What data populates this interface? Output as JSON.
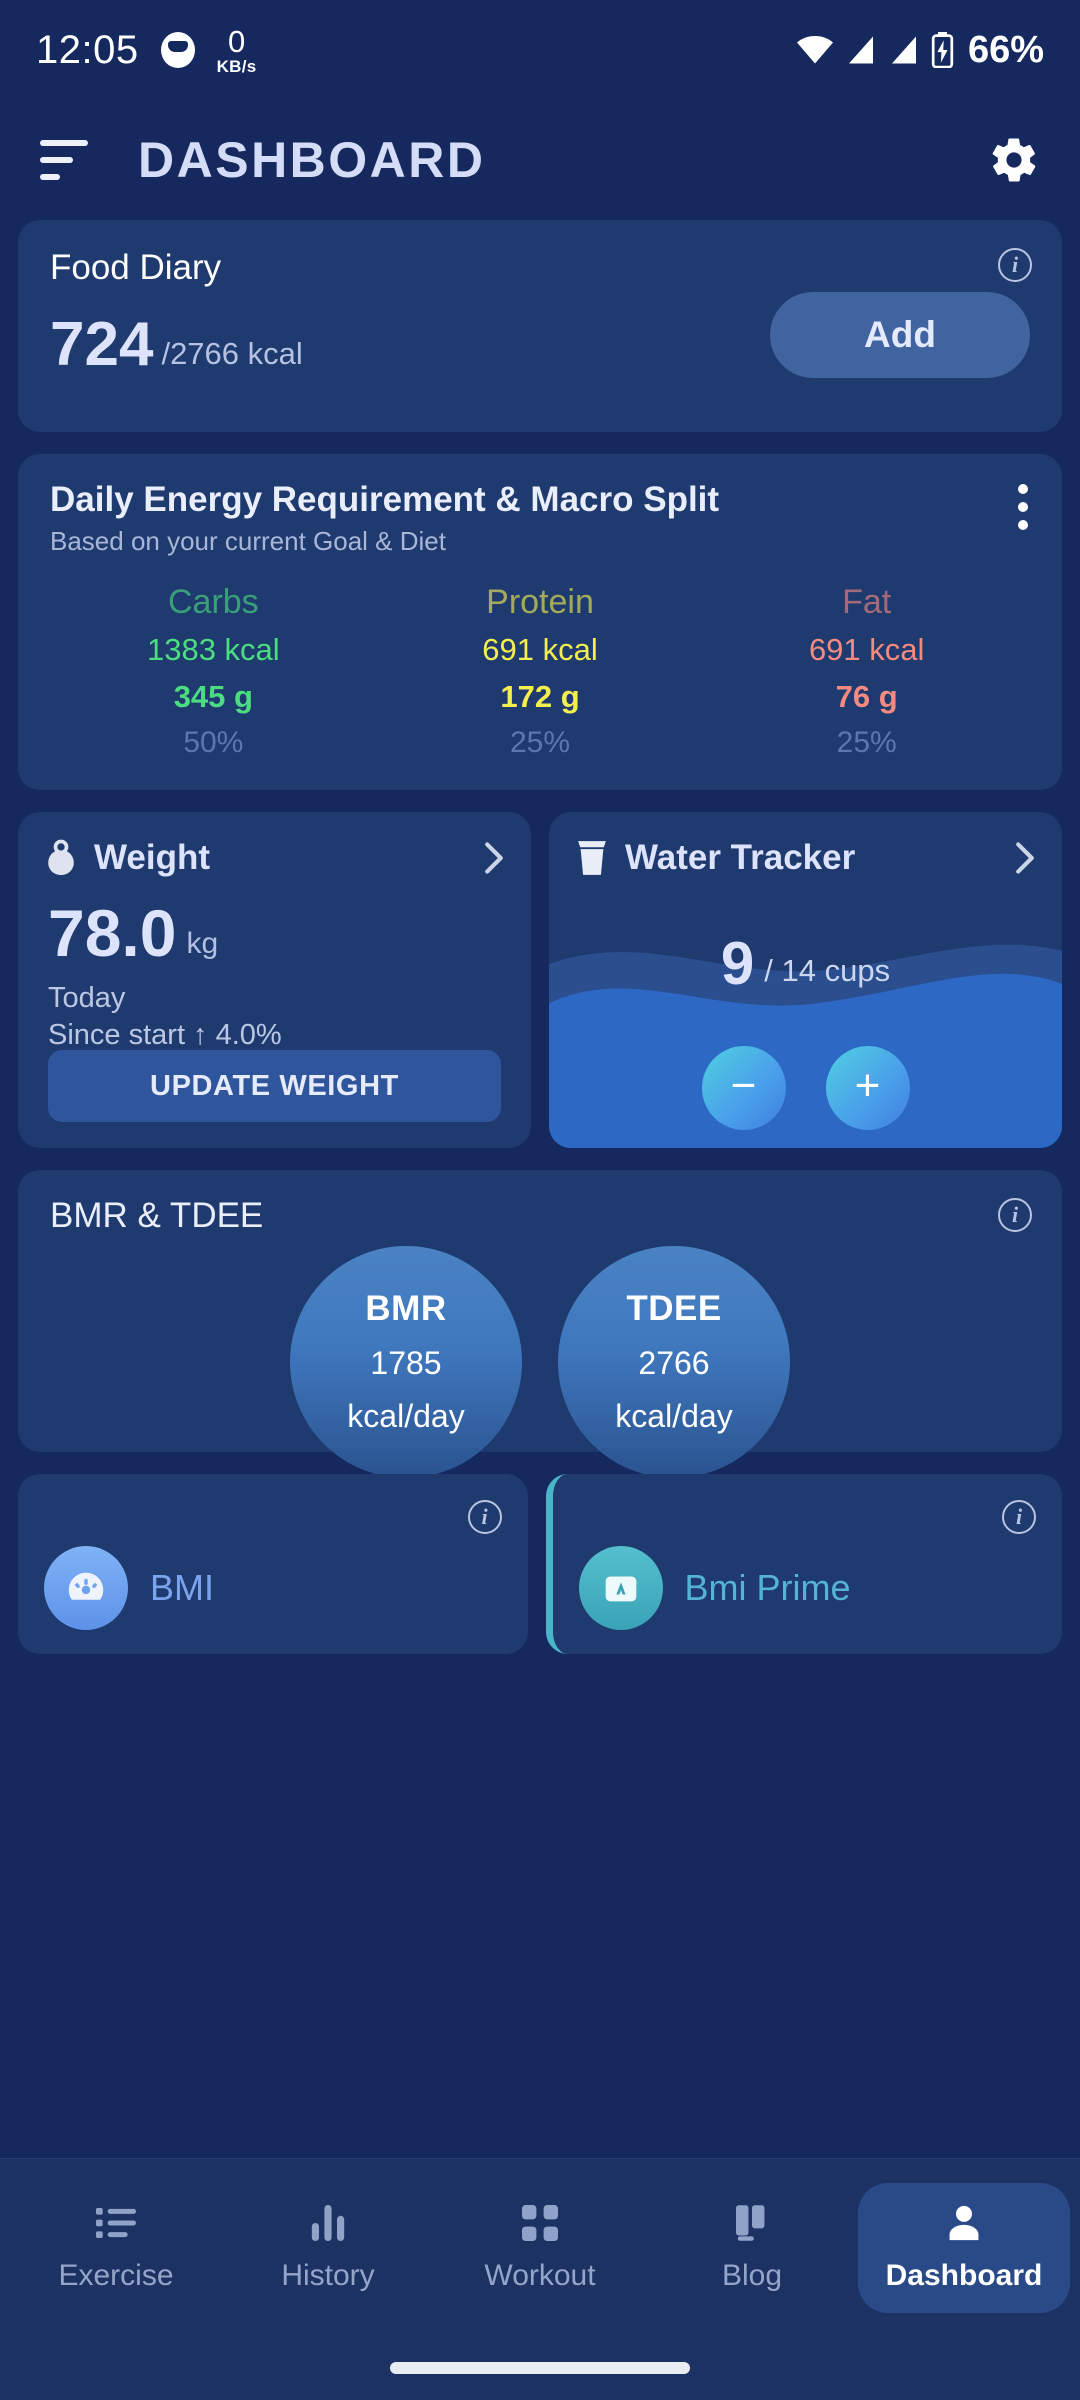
{
  "status_bar": {
    "time": "12:05",
    "net_speed_value": "0",
    "net_speed_unit": "KB/s",
    "battery_percent": "66%"
  },
  "app_bar": {
    "title": "DASHBOARD"
  },
  "food_diary": {
    "title": "Food Diary",
    "consumed": "724",
    "target": "/2766 kcal",
    "add_label": "Add",
    "info": "i"
  },
  "macro": {
    "title": "Daily Energy Requirement & Macro Split",
    "subtitle": "Based on your current Goal & Diet",
    "columns": [
      {
        "label": "Carbs",
        "kcal": "1383 kcal",
        "grams": "345 g",
        "percent": "50%",
        "color": "#4ade80"
      },
      {
        "label": "Protein",
        "kcal": "691 kcal",
        "grams": "172 g",
        "percent": "25%",
        "color": "#f5ef4e"
      },
      {
        "label": "Fat",
        "kcal": "691 kcal",
        "grams": "76 g",
        "percent": "25%",
        "color": "#f58a80"
      }
    ]
  },
  "weight": {
    "title": "Weight",
    "value": "78.0",
    "unit": "kg",
    "when": "Today",
    "since": "Since start ↑ 4.0%",
    "button": "UPDATE WEIGHT"
  },
  "water": {
    "title": "Water Tracker",
    "count": "9",
    "goal": "/ 14 cups",
    "minus": "−",
    "plus": "+"
  },
  "bmr_tdee": {
    "title": "BMR & TDEE",
    "info": "i",
    "bubbles": [
      {
        "key": "BMR",
        "value": "1785",
        "unit": "kcal/day"
      },
      {
        "key": "TDEE",
        "value": "2766",
        "unit": "kcal/day"
      }
    ]
  },
  "bmi_cards": [
    {
      "name": "BMI",
      "info": "i",
      "accent": "#7ba4ee"
    },
    {
      "name": "Bmi Prime",
      "info": "i",
      "accent": "#55b4d2"
    }
  ],
  "bottom_nav": {
    "items": [
      {
        "label": "Exercise",
        "icon": "list-icon",
        "active": false
      },
      {
        "label": "History",
        "icon": "bar-chart-icon",
        "active": false
      },
      {
        "label": "Workout",
        "icon": "grid-icon",
        "active": false
      },
      {
        "label": "Blog",
        "icon": "book-icon",
        "active": false
      },
      {
        "label": "Dashboard",
        "icon": "person-icon",
        "active": true
      }
    ]
  }
}
